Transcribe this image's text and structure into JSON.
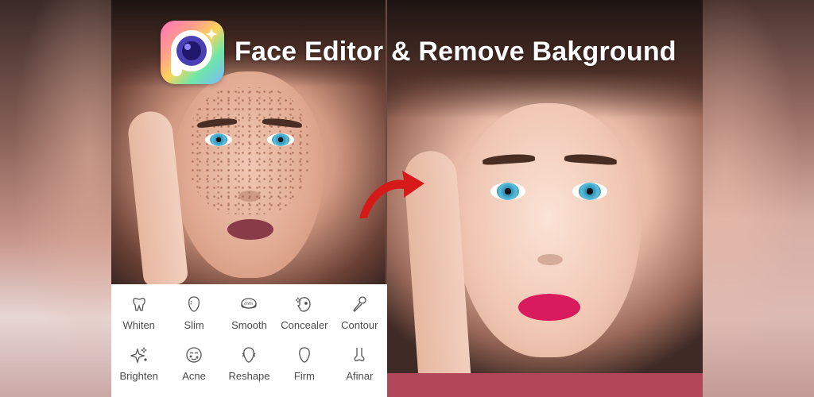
{
  "header": {
    "title": "Face Editor & Remove Bakground",
    "logo_icon": "camera-lens-p-logo-icon"
  },
  "toolbar": {
    "tools": [
      {
        "label": "Whiten",
        "icon": "tooth-icon"
      },
      {
        "label": "Slim",
        "icon": "face-outline-icon"
      },
      {
        "label": "Smooth",
        "icon": "compact-powder-icon"
      },
      {
        "label": "Concealer",
        "icon": "face-dot-icon"
      },
      {
        "label": "Contour",
        "icon": "brush-icon"
      },
      {
        "label": "Brighten",
        "icon": "sparkle-icon"
      },
      {
        "label": "Acne",
        "icon": "face-acne-icon"
      },
      {
        "label": "Reshape",
        "icon": "face-reshape-icon"
      },
      {
        "label": "Firm",
        "icon": "face-firm-icon"
      },
      {
        "label": "Afinar",
        "icon": "nose-icon"
      }
    ]
  },
  "colors": {
    "arrow": "#d61a1a",
    "lips_before": "#8a3b48",
    "lips_after": "#d81b5c",
    "toolbar_bg": "#ffffff",
    "label_text": "#4a4a4a"
  }
}
